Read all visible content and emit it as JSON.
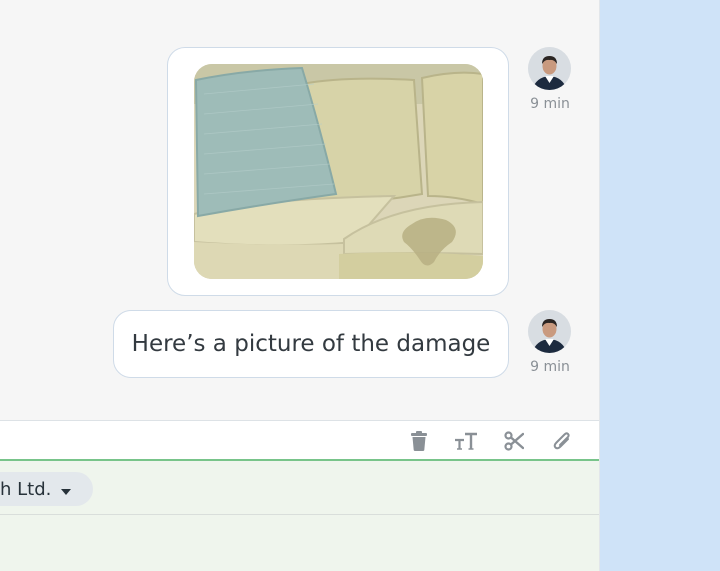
{
  "messages": [
    {
      "type": "image",
      "alt": "Photo of a beige sofa with a light blue cushion and a stain on the seat",
      "time": "9 min"
    },
    {
      "type": "text",
      "text": "Here’s a picture of the damage",
      "time": "9 min"
    }
  ],
  "toolbar": {
    "icons": [
      "trash-icon",
      "text-size-icon",
      "scissors-icon",
      "paperclip-icon"
    ]
  },
  "footer": {
    "company_label": "h Ltd."
  },
  "colors": {
    "background": "#cfe3f8",
    "chat_background": "#f6f6f6",
    "bubble_border": "#cfdbe8",
    "accent_green": "#78c48a",
    "icon_gray": "#8a9096"
  }
}
